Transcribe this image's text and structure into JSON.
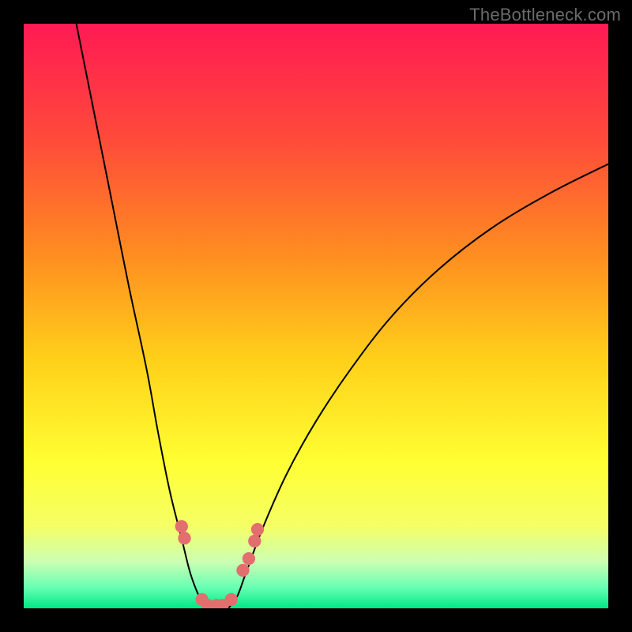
{
  "watermark": "TheBottleneck.com",
  "chart_data": {
    "type": "line",
    "title": "",
    "xlabel": "",
    "ylabel": "",
    "xlim": [
      0,
      100
    ],
    "ylim": [
      0,
      100
    ],
    "grid": false,
    "legend": false,
    "background_gradient_stops": [
      {
        "offset": 0.0,
        "color": "#ff1a53"
      },
      {
        "offset": 0.2,
        "color": "#ff4b3a"
      },
      {
        "offset": 0.4,
        "color": "#ff8f20"
      },
      {
        "offset": 0.58,
        "color": "#ffd21a"
      },
      {
        "offset": 0.75,
        "color": "#ffff33"
      },
      {
        "offset": 0.86,
        "color": "#f5ff66"
      },
      {
        "offset": 0.92,
        "color": "#ccffb3"
      },
      {
        "offset": 0.965,
        "color": "#66ffb3"
      },
      {
        "offset": 1.0,
        "color": "#00e884"
      }
    ],
    "series": [
      {
        "name": "left-branch",
        "x": [
          9,
          12,
          15,
          18,
          21,
          23,
          25,
          27,
          28.5,
          30,
          31
        ],
        "values": [
          100,
          85,
          70,
          55,
          41,
          30,
          20,
          12,
          6,
          2,
          0
        ]
      },
      {
        "name": "right-branch",
        "x": [
          35,
          36.5,
          38,
          41,
          45,
          50,
          56,
          63,
          71,
          80,
          90,
          100
        ],
        "values": [
          0,
          2,
          6,
          14,
          23,
          32,
          41,
          50,
          58,
          65,
          71,
          76
        ]
      }
    ],
    "markers": {
      "color": "#e36e6e",
      "radius_viewunits": 1.1,
      "points": [
        {
          "x": 27.0,
          "y": 14.0
        },
        {
          "x": 27.5,
          "y": 12.0
        },
        {
          "x": 30.5,
          "y": 1.5
        },
        {
          "x": 31.5,
          "y": 0.5
        },
        {
          "x": 33.0,
          "y": 0.5
        },
        {
          "x": 34.0,
          "y": 0.5
        },
        {
          "x": 35.5,
          "y": 1.5
        },
        {
          "x": 37.5,
          "y": 6.5
        },
        {
          "x": 38.5,
          "y": 8.5
        },
        {
          "x": 39.5,
          "y": 11.5
        },
        {
          "x": 40.0,
          "y": 13.5
        }
      ]
    }
  }
}
